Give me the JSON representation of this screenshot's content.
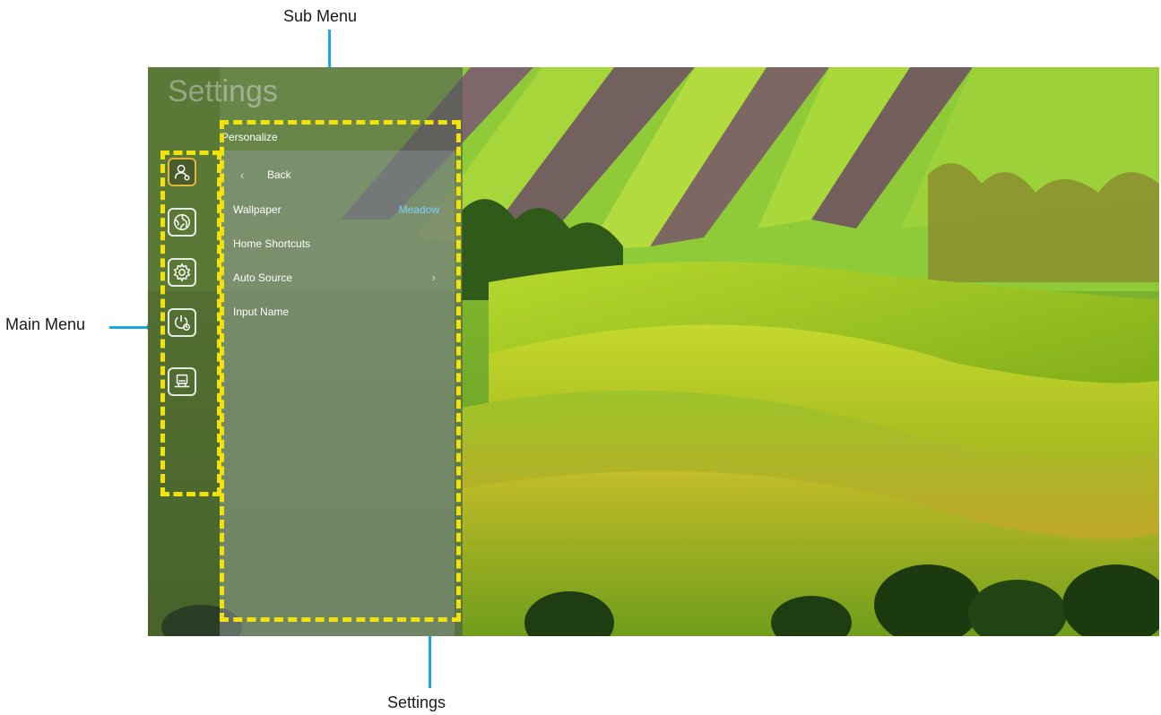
{
  "annotations": {
    "sub_menu": "Sub Menu",
    "main_menu": "Main Menu",
    "settings": "Settings"
  },
  "screen": {
    "title": "Settings",
    "main_menu_icons": [
      "user-personalize-icon",
      "network-globe-icon",
      "gear-settings-icon",
      "power-timer-icon",
      "display-projector-icon"
    ],
    "sub_menu": {
      "heading": "Personalize",
      "items": [
        {
          "label": "Back",
          "value": "",
          "indicator": "chevron-left"
        },
        {
          "label": "Wallpaper",
          "value": "Meadow"
        },
        {
          "label": "Home Shortcuts",
          "value": ""
        },
        {
          "label": "Auto Source",
          "value": "",
          "indicator": "chevron-right"
        },
        {
          "label": "Input Name",
          "value": ""
        }
      ]
    }
  },
  "colors": {
    "annotation_blue": "#1ba7e0",
    "highlight_yellow": "#f2e20a",
    "active_icon_border": "#e6b43a",
    "value_blue": "#7ad0ff"
  }
}
